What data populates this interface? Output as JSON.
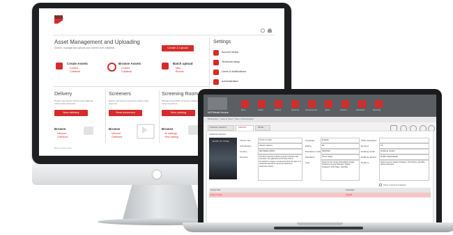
{
  "imac": {
    "logo": "MIA",
    "header": {
      "title": "Asset Management and Uploading",
      "subtitle": "Search, manage and upload your content and collateral."
    },
    "create_upload": "Create & Upload",
    "create_assets": {
      "title": "Create Assets",
      "items": [
        "Content",
        "Collateral"
      ]
    },
    "browse_assets": {
      "title": "Browse Assets",
      "items": [
        "Content",
        "Collateral"
      ]
    },
    "batch_upload": {
      "title": "Batch upload",
      "items": [
        "New",
        "Browse"
      ]
    },
    "settings": {
      "title": "Settings",
      "items": [
        "Account setup",
        "Technical setup",
        "Users & Notifications",
        "Administration"
      ]
    },
    "delivery": {
      "title": "Delivery",
      "desc": "Deliver and receive content and collateral to/from other accounts.",
      "button": "New delivery",
      "browse": "Browse",
      "links": [
        "Inbound",
        "Outbound"
      ]
    },
    "screeners": {
      "title": "Screeners",
      "desc": "Deliver and receive screeners to/from other accounts.",
      "button": "Send screeners",
      "browse": "Browse",
      "links": [
        "Inbound",
        "Outbound"
      ]
    },
    "screening_room": {
      "title": "Screening Room",
      "desc": "Manage and publish screeners catalog to MCP Screening Room.",
      "button": "New catalog",
      "browse": "Browse",
      "links": [
        "All catalogs",
        "View catalog"
      ]
    },
    "footer": "Bantu Screen Pilot"
  },
  "macbook": {
    "brand": "MCPMedia Service",
    "nav": [
      "Home",
      "Assets",
      "Delivery",
      "Screeners",
      "Screening room",
      "Ingest",
      "Services",
      "Dashboard",
      "Reporting"
    ],
    "breadcrumb": "Marketplace > Tears of Steel > Tears of Steel English",
    "tabs": [
      "ORIGINAL VERSION",
      "VERSION",
      "DETAIL"
    ],
    "section": "VERSION DETAIL",
    "poster_title": "TEARS OF STEEL",
    "fields_left": [
      {
        "label": "Version title",
        "value": "Tears of steel"
      },
      {
        "label": "Subcategory",
        "value": "Select options"
      },
      {
        "label": "Country",
        "value": "NETHERLANDS"
      },
      {
        "label": "Storyline",
        "value": "The film's premise is about a group of warriors and scientists, who gathered at the Oude Kerk in Amsterdam to stage a crucial event from the past, in a desperate attempt to rescue the world from destructive robots."
      }
    ],
    "fields_mid": [
      {
        "label": "Language",
        "value": "English"
      },
      {
        "label": "Rating",
        "value": "NL"
      },
      {
        "label": "Distributor number",
        "value": "0000336"
      },
      {
        "label": "Distributor",
        "value": "Ohne Hase"
      },
      {
        "label": "Cast",
        "value": "Derek de Lint, Sergio Hasselbaink, Rogier Schippers, Denise Rebergen, Rogier Schippers, Chris Haley, Jody Bhe"
      }
    ],
    "fields_right": [
      {
        "label": "Other languages",
        "value": ""
      },
      {
        "label": "Runtime",
        "value": "12"
      },
      {
        "label": "Dubbing studio",
        "value": "Dubbing Studio"
      },
      {
        "label": "Dubbing director",
        "value": "Dubbi Hasselbaink"
      },
      {
        "label": "Dubbers",
        "value": "Henk Koevoets, Rogier Schippers, Chris Haley, Jody Bhe, Denise Rebergen"
      }
    ],
    "table_toolbar": "Show expired and deleted",
    "table_headers": [
      "Version title",
      "Language"
    ],
    "table_rows": [
      [
        "Tears of steel",
        "English"
      ]
    ]
  }
}
